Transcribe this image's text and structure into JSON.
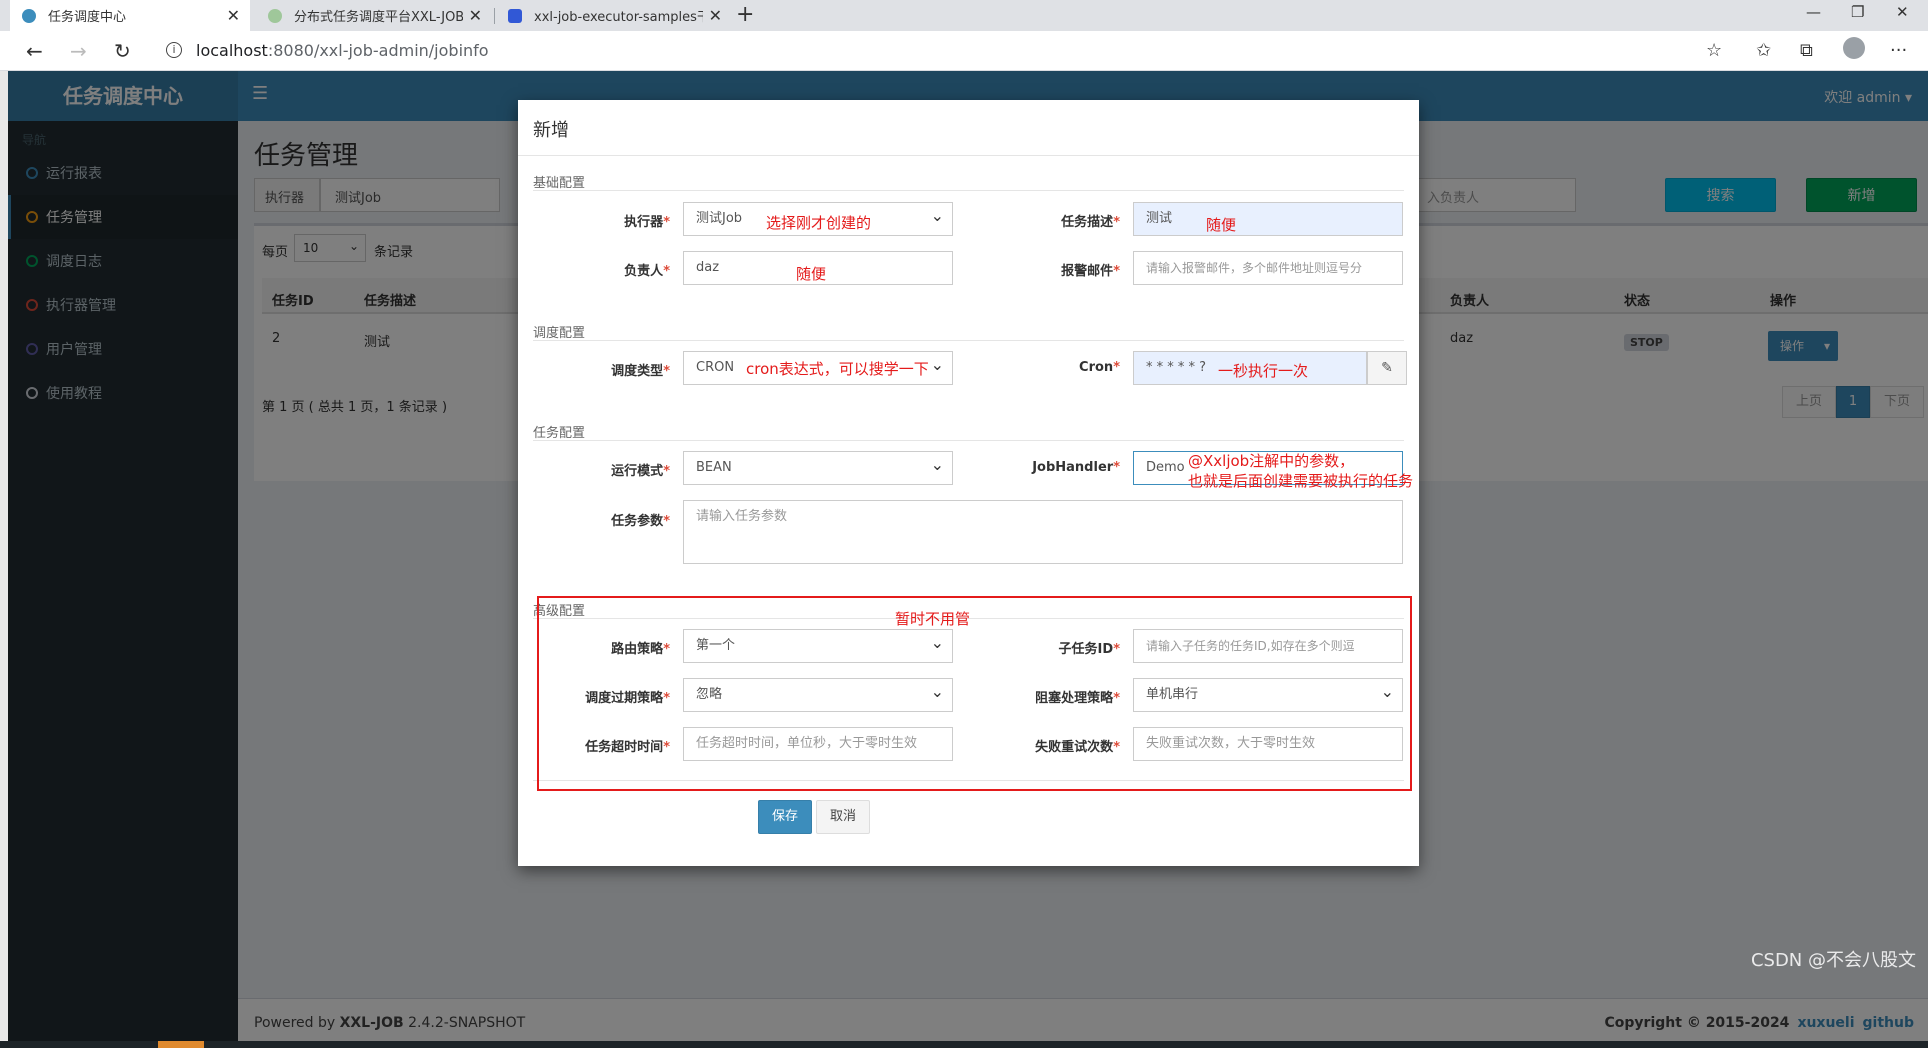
{
  "browser": {
    "tabs": [
      {
        "title": "任务调度中心",
        "active": true
      },
      {
        "title": "分布式任务调度平台XXL-JOB",
        "active": false
      },
      {
        "title": "xxl-job-executor-samples干嘛的",
        "active": false
      }
    ],
    "url_host": "localhost",
    "url_path": ":8080/xxl-job-admin/jobinfo"
  },
  "app": {
    "logo": "任务调度中心",
    "welcome": "欢迎 admin ▾",
    "nav_header": "导航",
    "nav": [
      {
        "label": "运行报表",
        "color": "#3c8dbc"
      },
      {
        "label": "任务管理",
        "color": "#f39c12",
        "active": true
      },
      {
        "label": "调度日志",
        "color": "#00a65a"
      },
      {
        "label": "执行器管理",
        "color": "#dd4b39"
      },
      {
        "label": "用户管理",
        "color": "#605ca8"
      },
      {
        "label": "使用教程",
        "color": "#d2d6de"
      }
    ],
    "page_title": "任务管理",
    "filter": {
      "executor_label": "执行器",
      "executor_value": "测试Job",
      "owner_placeholder": "入负责人"
    },
    "search_label": "搜索",
    "add_label": "新增",
    "per_page": {
      "prefix": "每页",
      "value": "10",
      "suffix": "条记录"
    },
    "table": {
      "headers": [
        "任务ID",
        "任务描述",
        "负责人",
        "状态",
        "操作"
      ],
      "row": {
        "id": "2",
        "desc": "测试",
        "owner": "daz",
        "status": "STOP",
        "op": "操作"
      }
    },
    "pagination_info": "第 1 页 ( 总共 1 页，1 条记录 )",
    "pager": {
      "prev": "上页",
      "current": "1",
      "next": "下页"
    },
    "footer": {
      "powered_prefix": "Powered by ",
      "product": "XXL-JOB",
      "version": " 2.4.2-SNAPSHOT",
      "copyright": "Copyright © 2015-2024",
      "author_link": "xuxueli",
      "github_link": "github"
    },
    "watermark": "CSDN @不会八股文"
  },
  "modal": {
    "title": "新增",
    "sections": {
      "basic": "基础配置",
      "schedule": "调度配置",
      "task": "任务配置",
      "advanced": "高级配置"
    },
    "fields": {
      "executor": {
        "label": "执行器",
        "value": "测试Job"
      },
      "desc": {
        "label": "任务描述",
        "value": "测试"
      },
      "owner": {
        "label": "负责人",
        "value": "daz"
      },
      "alarm_email": {
        "label": "报警邮件",
        "placeholder": "请输入报警邮件，多个邮件地址则逗号分"
      },
      "schedule_type": {
        "label": "调度类型",
        "value": "CRON"
      },
      "cron": {
        "label": "Cron",
        "value": "* * * * * ?"
      },
      "run_mode": {
        "label": "运行模式",
        "value": "BEAN"
      },
      "job_handler": {
        "label": "JobHandler",
        "value": "Demo"
      },
      "task_param": {
        "label": "任务参数",
        "placeholder": "请输入任务参数"
      },
      "route": {
        "label": "路由策略",
        "value": "第一个"
      },
      "child_job": {
        "label": "子任务ID",
        "placeholder": "请输入子任务的任务ID,如存在多个则逗"
      },
      "misfire": {
        "label": "调度过期策略",
        "value": "忽略"
      },
      "block": {
        "label": "阻塞处理策略",
        "value": "单机串行"
      },
      "timeout": {
        "label": "任务超时时间",
        "placeholder": "任务超时时间，单位秒，大于零时生效"
      },
      "retry": {
        "label": "失败重试次数",
        "placeholder": "失败重试次数，大于零时生效"
      }
    },
    "save_label": "保存",
    "cancel_label": "取消",
    "required_mark": "*"
  },
  "annotations": {
    "executor": "选择刚才创建的",
    "desc": "随便",
    "owner": "随便",
    "schedule_type": "cron表达式，可以搜学一下",
    "cron": "一秒执行一次",
    "handler_line1": "@Xxljob注解中的参数，",
    "handler_line2": "也就是后面创建需要被执行的任务",
    "advanced": "暂时不用管"
  }
}
